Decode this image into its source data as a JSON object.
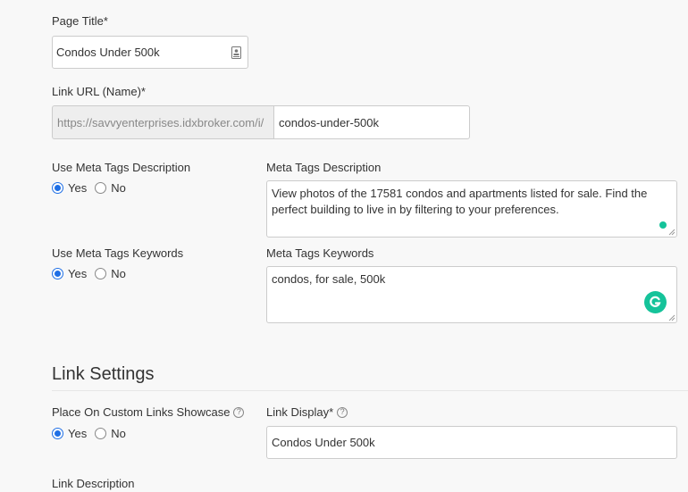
{
  "page_title": {
    "label": "Page Title*",
    "value": "Condos Under 500k"
  },
  "link_url": {
    "label": "Link URL (Name)*",
    "prefix": "https://savvyenterprises.idxbroker.com/i/",
    "value": "condos-under-500k"
  },
  "meta_description": {
    "use_label": "Use Meta Tags Description",
    "yes_label": "Yes",
    "no_label": "No",
    "selected": "yes",
    "field_label": "Meta Tags Description",
    "value": "View photos of the 17581 condos and apartments listed for sale. Find the perfect building to live in by filtering to your preferences."
  },
  "meta_keywords": {
    "use_label": "Use Meta Tags Keywords",
    "yes_label": "Yes",
    "no_label": "No",
    "selected": "yes",
    "field_label": "Meta Tags Keywords",
    "value": "condos, for sale, 500k"
  },
  "link_settings": {
    "title": "Link Settings",
    "showcase_label": "Place On Custom Links Showcase",
    "yes_label": "Yes",
    "no_label": "No",
    "selected": "yes",
    "link_display_label": "Link Display*",
    "link_display_value": "Condos Under 500k",
    "link_description_label": "Link Description"
  },
  "icons": {
    "contact_card": "contact-card-icon",
    "grammarly": "grammarly-icon",
    "help": "question-circle-icon"
  },
  "colors": {
    "radio_accent": "#1f6fe5",
    "grammarly_green": "#15c39a"
  }
}
